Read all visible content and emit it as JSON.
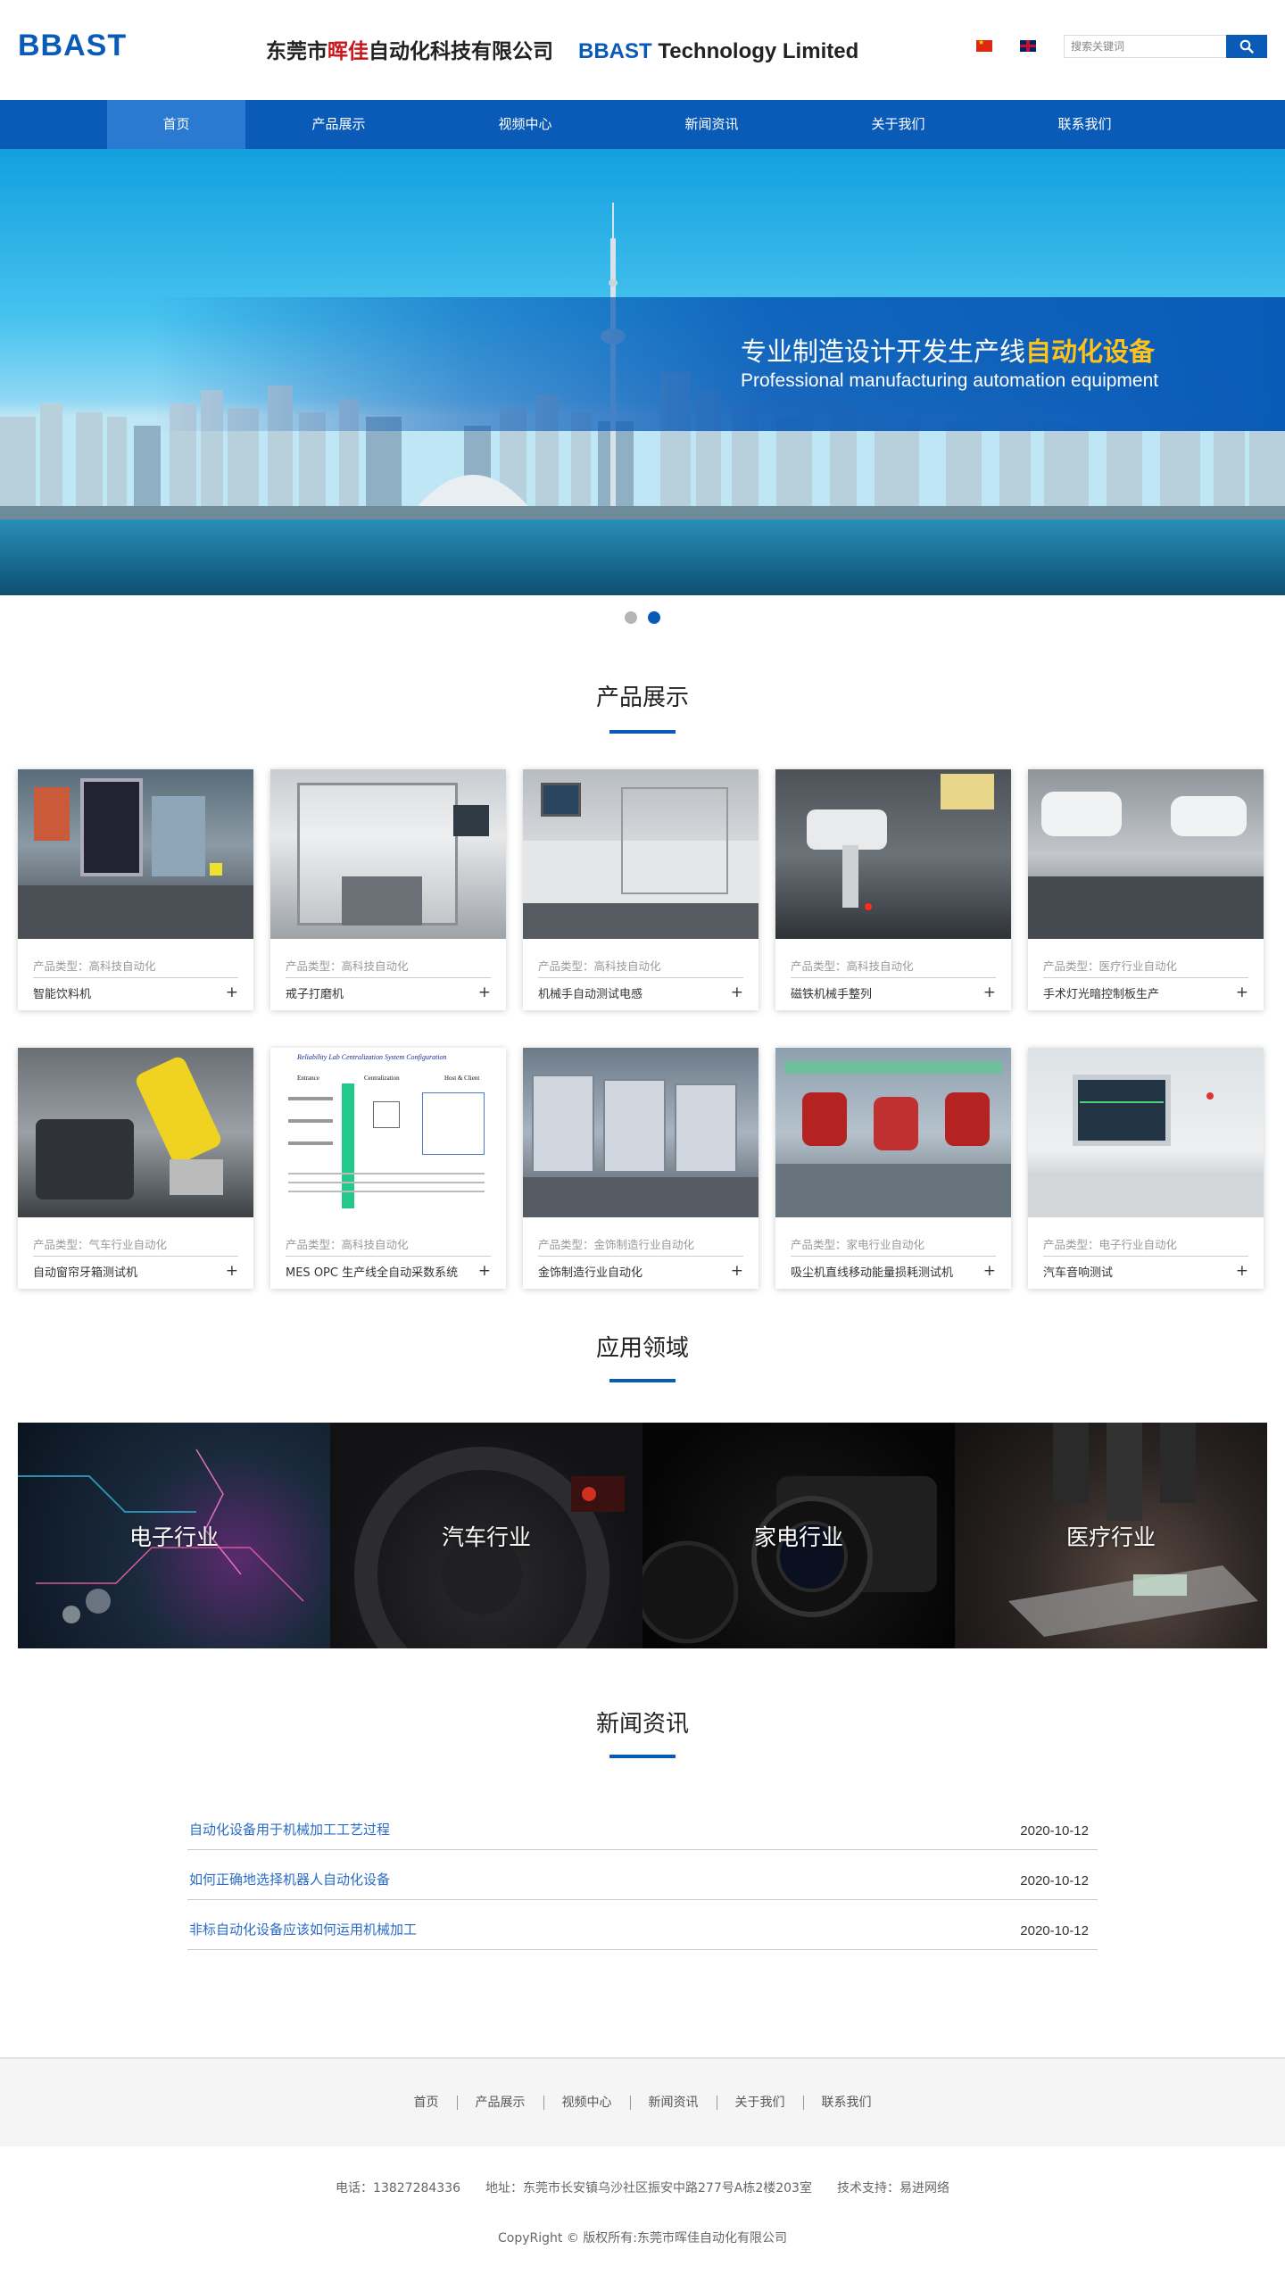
{
  "header": {
    "logo": "BBAST",
    "company_cn_prefix": "东莞市",
    "company_cn_highlight": "晖佳",
    "company_cn_suffix": "自动化科技有限公司",
    "company_en_bold": "BBAST",
    "company_en_rest": " Technology Limited",
    "search_placeholder": "搜索关键词",
    "colors": {
      "brand": "#0a5bb7",
      "highlight": "#c8161d"
    }
  },
  "nav": {
    "items": [
      {
        "label": "首页"
      },
      {
        "label": "产品展示"
      },
      {
        "label": "视频中心"
      },
      {
        "label": "新闻资讯"
      },
      {
        "label": "关于我们"
      },
      {
        "label": "联系我们"
      }
    ]
  },
  "banner": {
    "title_prefix": "专业制造设计开发生产线",
    "title_accent": "自动化设备",
    "subtitle": "Professional manufacturing automation equipment",
    "accent_color": "#ffc21a",
    "slide_count": 2,
    "active_slide": 2
  },
  "products": {
    "title": "产品展示",
    "items": [
      {
        "category": "产品类型：高科技自动化",
        "name": "智能饮料机"
      },
      {
        "category": "产品类型：高科技自动化",
        "name": "戒子打磨机"
      },
      {
        "category": "产品类型：高科技自动化",
        "name": "机械手自动测试电感"
      },
      {
        "category": "产品类型：高科技自动化",
        "name": "磁铁机械手整列"
      },
      {
        "category": "产品类型：医疗行业自动化",
        "name": "手术灯光暗控制板生产"
      },
      {
        "category": "产品类型：气车行业自动化",
        "name": "自动窗帘牙箱测试机"
      },
      {
        "category": "产品类型：高科技自动化",
        "name": "MES OPC 生产线全自动采数系统"
      },
      {
        "category": "产品类型：金饰制造行业自动化",
        "name": "金饰制造行业自动化"
      },
      {
        "category": "产品类型：家电行业自动化",
        "name": "吸尘机直线移动能量损耗测试机"
      },
      {
        "category": "产品类型：电子行业自动化",
        "name": "汽车音响测试"
      }
    ],
    "diagram_text": {
      "title": "Reliability Lab Centralization System Configuration",
      "c1": "Entrance",
      "c2": "Centralization",
      "c3": "Host & Client"
    }
  },
  "applications": {
    "title": "应用领域",
    "items": [
      {
        "label": "电子行业"
      },
      {
        "label": "汽车行业"
      },
      {
        "label": "家电行业"
      },
      {
        "label": "医疗行业"
      }
    ]
  },
  "news": {
    "title": "新闻资讯",
    "items": [
      {
        "title": "自动化设备用于机械加工工艺过程",
        "date": "2020-10-12"
      },
      {
        "title": "如何正确地选择机器人自动化设备",
        "date": "2020-10-12"
      },
      {
        "title": "非标自动化设备应该如何运用机械加工",
        "date": "2020-10-12"
      }
    ]
  },
  "footer": {
    "nav": [
      {
        "label": "首页"
      },
      {
        "label": "产品展示"
      },
      {
        "label": "视频中心"
      },
      {
        "label": "新闻资讯"
      },
      {
        "label": "关于我们"
      },
      {
        "label": "联系我们"
      }
    ],
    "phone": "电话：13827284336",
    "address": "地址：东莞市长安镇乌沙社区振安中路277号A栋2楼203室",
    "support": "技术支持：易进网络",
    "copyright": "CopyRight © 版权所有:东莞市晖佳自动化有限公司"
  }
}
